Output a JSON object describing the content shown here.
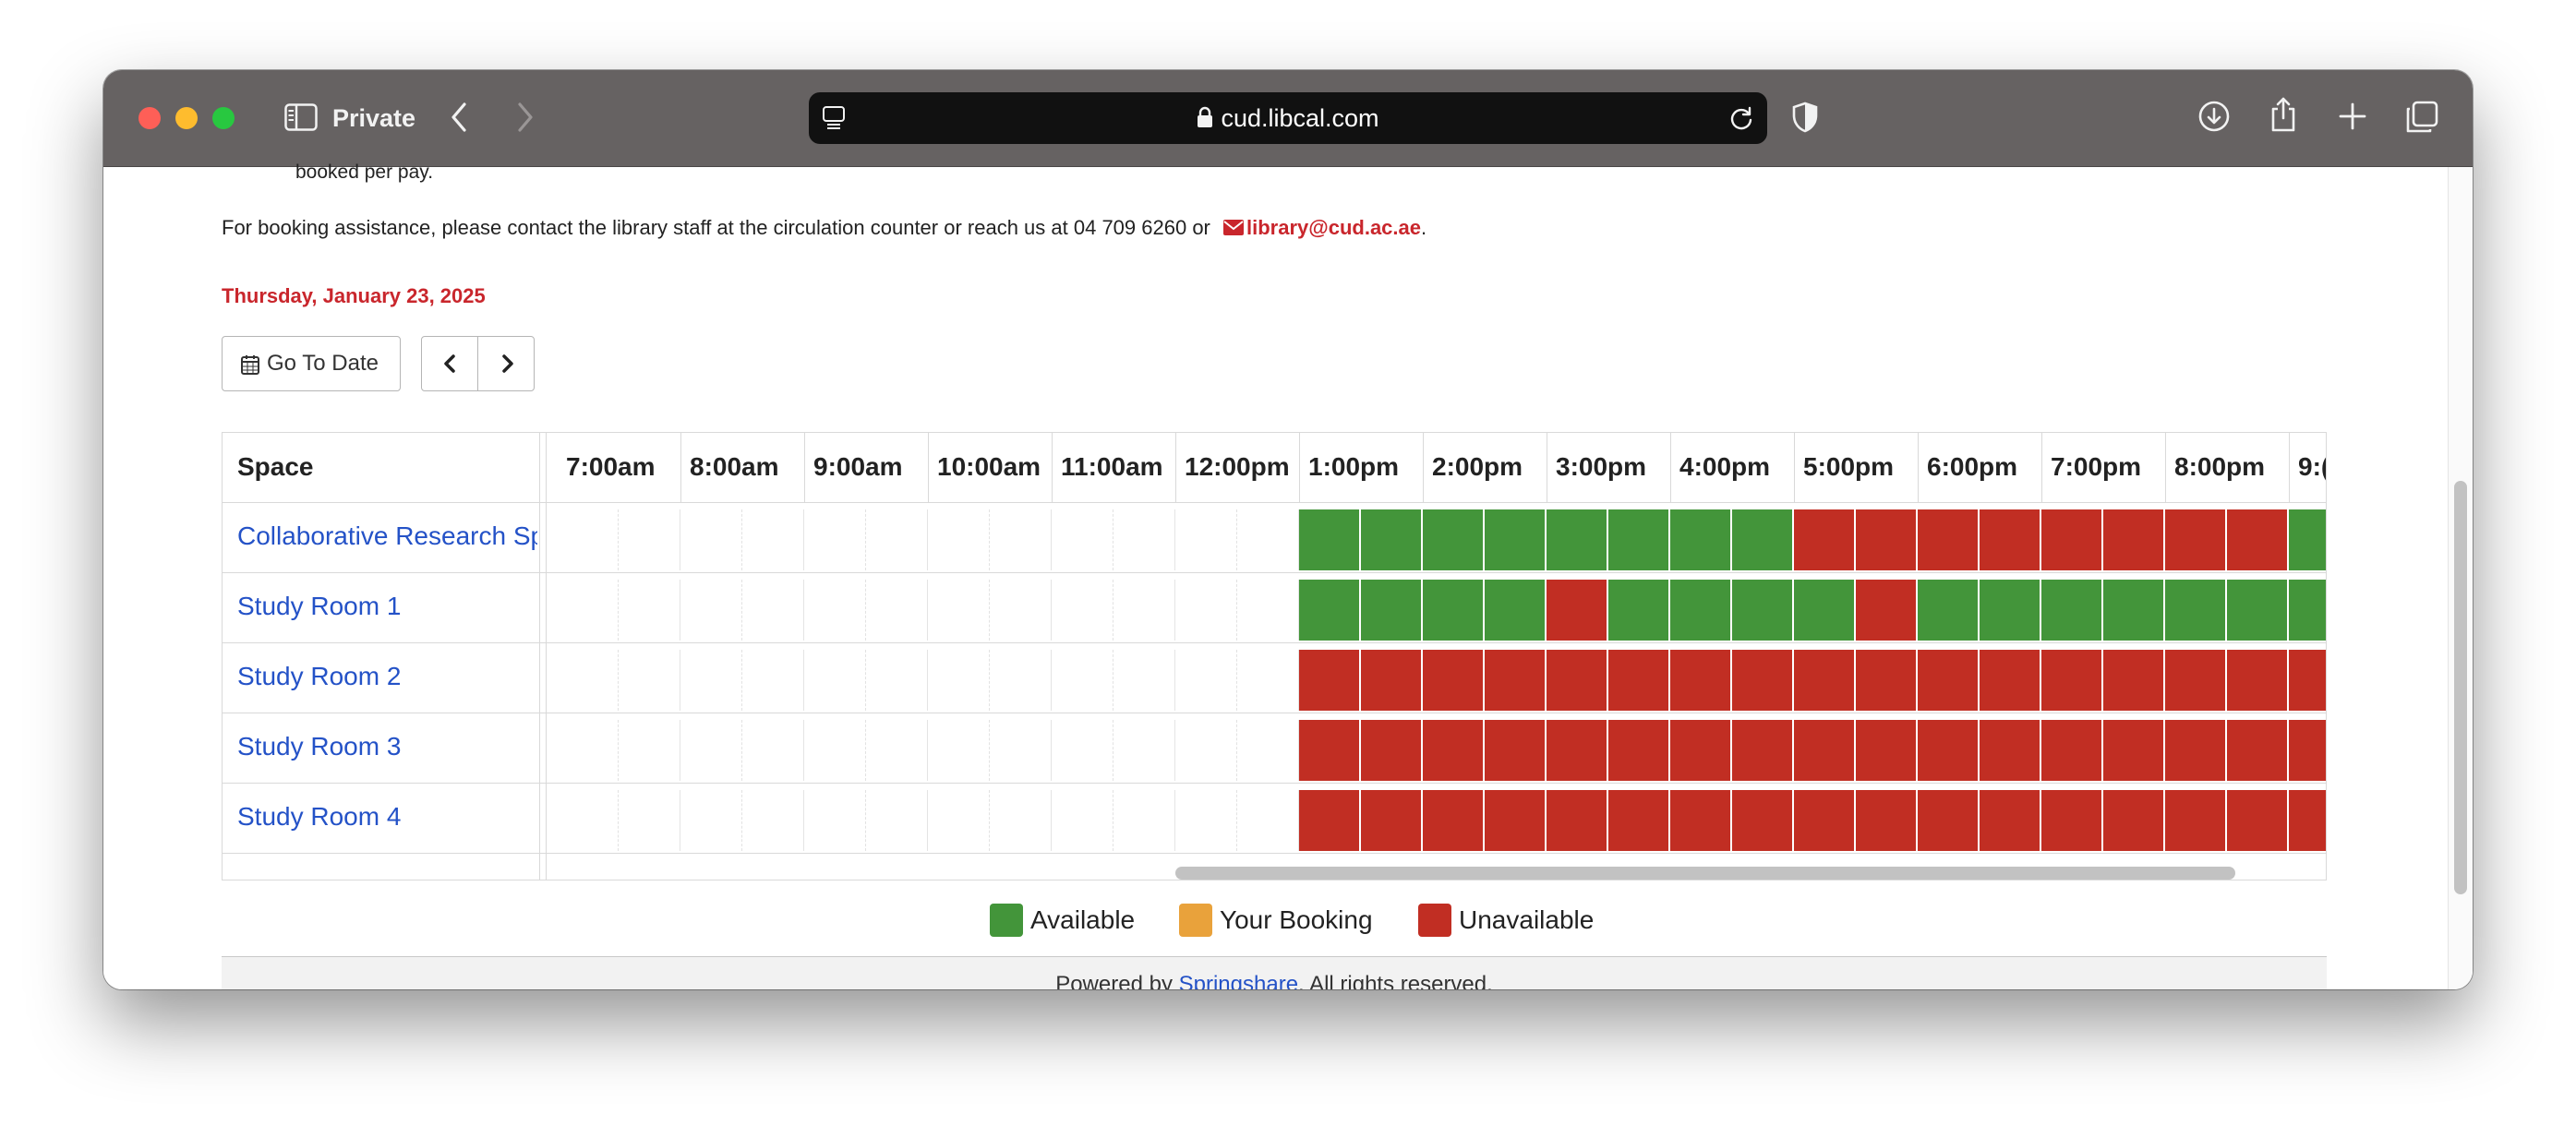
{
  "browser": {
    "private_label": "Private",
    "url": "cud.libcal.com"
  },
  "page": {
    "truncated_note": "booked per pay.",
    "assistance_text": "For booking assistance, please contact the library staff at the circulation counter or reach us at 04 709 6260 or",
    "email": "library@cud.ac.ae",
    "email_suffix": ".",
    "date_heading": "Thursday, January 23, 2025",
    "go_to_date_label": "Go To Date"
  },
  "grid": {
    "space_header": "Space",
    "hours": [
      "7:00am",
      "8:00am",
      "9:00am",
      "10:00am",
      "11:00am",
      "12:00pm",
      "1:00pm",
      "2:00pm",
      "3:00pm",
      "4:00pm",
      "5:00pm",
      "6:00pm",
      "7:00pm",
      "8:00pm",
      "9:("
    ],
    "rooms": [
      {
        "name": "Collaborative Research Space",
        "slots": "............AAAAAAAAUUUUUUUUAAAAAAAAAA"
      },
      {
        "name": "Study Room 1",
        "slots": "............AAAAUAAAAUAAAAAAAAAAAAAAAA"
      },
      {
        "name": "Study Room 2",
        "slots": "............UUUUUUUUUUUUUUUUUUUAAAAAAA"
      },
      {
        "name": "Study Room 3",
        "slots": "............UUUUUUUUUUUUUUUUUUUUUUUUUU"
      },
      {
        "name": "Study Room 4",
        "slots": "............UUUUUUUUUUUUUUUUUUUUUUUUUU"
      }
    ]
  },
  "legend": [
    {
      "label": "Available",
      "color": "#43953a"
    },
    {
      "label": "Your Booking",
      "color": "#e9a23b"
    },
    {
      "label": "Unavailable",
      "color": "#c12e23"
    }
  ],
  "footer": {
    "prefix": "Powered by",
    "link": "Springshare",
    "suffix": ". All rights reserved."
  },
  "colors": {
    "available": "#43953a",
    "unavailable": "#c12e23",
    "date_heading": "#c9262c",
    "link": "#2452c7"
  }
}
